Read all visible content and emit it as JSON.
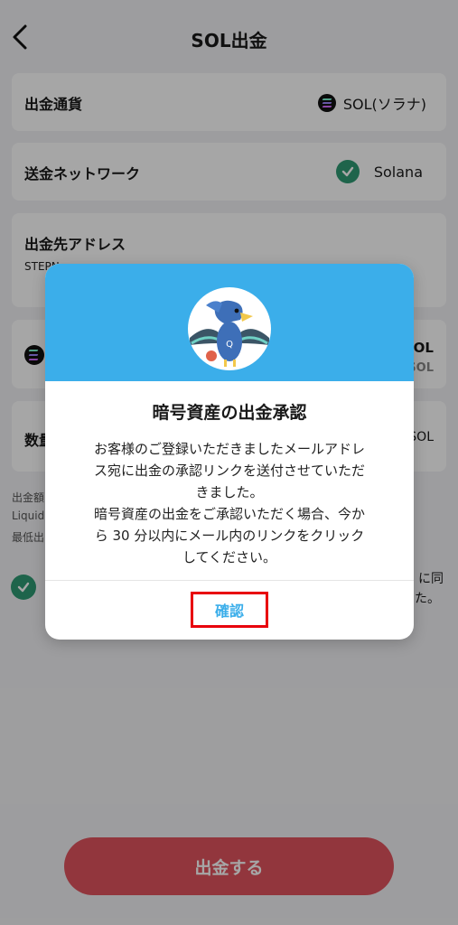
{
  "header": {
    "title": "SOL出金"
  },
  "currency": {
    "label": "出金通貨",
    "value": "SOL(ソラナ)"
  },
  "network": {
    "label": "送金ネットワーク",
    "value": "Solana"
  },
  "address": {
    "label": "出金先アドレス",
    "value": "STEPN"
  },
  "balance": {
    "value_partial": "SOL",
    "sub_partial": "SOL"
  },
  "amount": {
    "label_partial": "数量",
    "unit_partial": "SOL"
  },
  "notes": {
    "line1": "出金額",
    "line2": "Liquid",
    "line3": "最低出"
  },
  "agree": {
    "text_partial_1": "に同",
    "text_partial_2": "た。"
  },
  "submit": {
    "label": "出金する"
  },
  "modal": {
    "title": "暗号資産の出金承認",
    "message_lines": [
      "お客様のご登録いただきましたメールアドレ",
      "ス宛に出金の承認リンクを送付させていただ",
      "きました。",
      "暗号資産の出金をご承認いただく場合、今か",
      "ら 30 分以内にメール内のリンクをクリック",
      "してください。"
    ],
    "confirm_label": "確認"
  },
  "colors": {
    "accent": "#3baeea",
    "success": "#2f9a73",
    "submit": "#e0545f",
    "highlight": "#e8000b"
  },
  "icons": [
    "back-chevron-icon",
    "solana-icon",
    "check-icon",
    "mascot-bird-icon"
  ]
}
